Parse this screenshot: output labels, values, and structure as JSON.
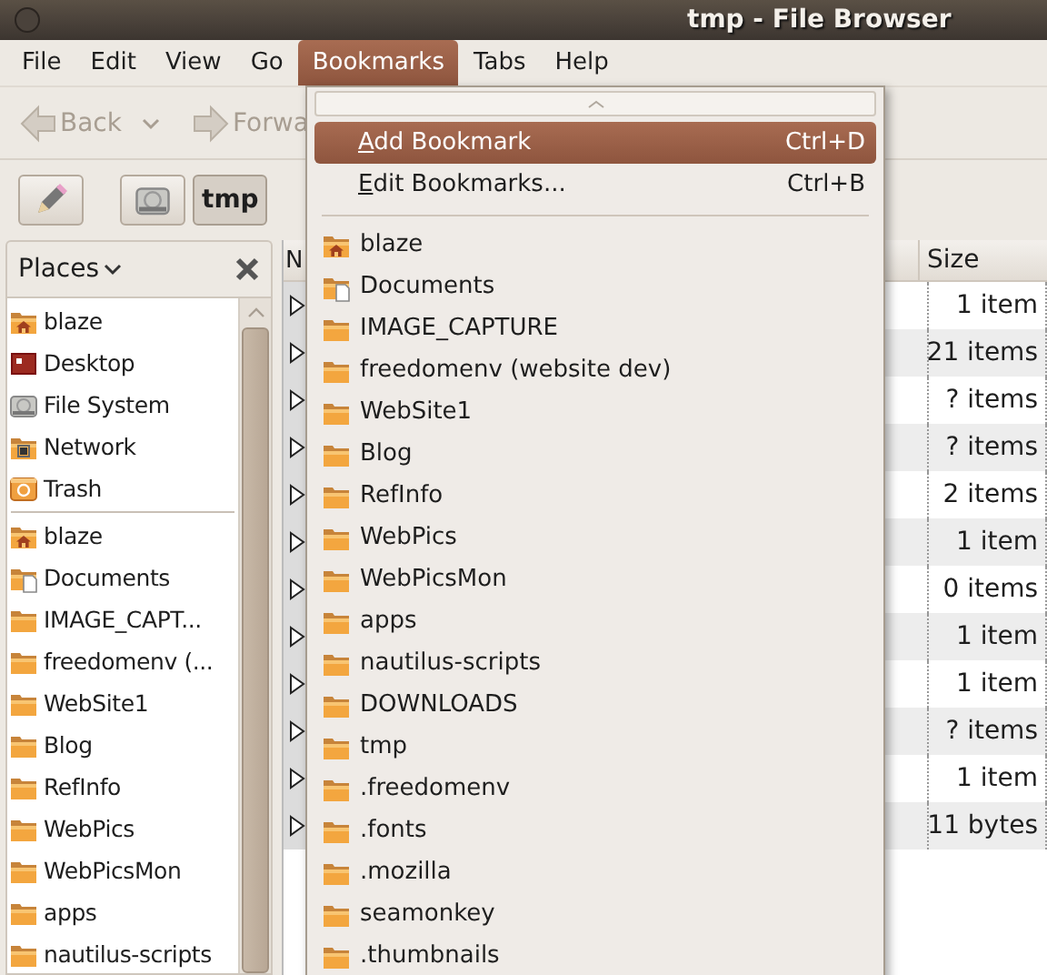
{
  "window": {
    "title": "tmp - File Browser"
  },
  "menubar": [
    {
      "label": "File",
      "selected": false
    },
    {
      "label": "Edit",
      "selected": false
    },
    {
      "label": "View",
      "selected": false
    },
    {
      "label": "Go",
      "selected": false
    },
    {
      "label": "Bookmarks",
      "selected": true
    },
    {
      "label": "Tabs",
      "selected": false
    },
    {
      "label": "Help",
      "selected": false
    }
  ],
  "toolbar": [
    {
      "kind": "back",
      "label": "Back",
      "disabled": true
    },
    {
      "kind": "forward",
      "label": "Forwa",
      "disabled": true
    }
  ],
  "path_bar": [
    {
      "kind": "drive",
      "selected": false
    },
    {
      "kind": "text",
      "label": "tmp",
      "selected": true
    }
  ],
  "sidebar": {
    "title": "Places",
    "items": [
      {
        "kind": "home",
        "label": "blaze"
      },
      {
        "kind": "desktop",
        "label": "Desktop"
      },
      {
        "kind": "drive",
        "label": "File System"
      },
      {
        "kind": "network",
        "label": "Network"
      },
      {
        "kind": "trash",
        "label": "Trash"
      },
      {
        "kind": "separator"
      },
      {
        "kind": "home",
        "label": "blaze"
      },
      {
        "kind": "documents",
        "label": "Documents"
      },
      {
        "kind": "folder",
        "label": "IMAGE_CAPT..."
      },
      {
        "kind": "folder",
        "label": "freedomenv (..."
      },
      {
        "kind": "folder",
        "label": "WebSite1"
      },
      {
        "kind": "folder",
        "label": "Blog"
      },
      {
        "kind": "folder",
        "label": "RefInfo"
      },
      {
        "kind": "folder",
        "label": "WebPics"
      },
      {
        "kind": "folder",
        "label": "WebPicsMon"
      },
      {
        "kind": "folder",
        "label": "apps"
      },
      {
        "kind": "folder",
        "label": "nautilus-scripts"
      }
    ]
  },
  "table": {
    "columns": [
      "N",
      "Size"
    ],
    "rows": [
      {
        "size": "1 item"
      },
      {
        "size": "21 items"
      },
      {
        "size": "? items"
      },
      {
        "size": "? items"
      },
      {
        "size": "2 items"
      },
      {
        "size": "1 item"
      },
      {
        "size": "0 items"
      },
      {
        "size": "1 item"
      },
      {
        "size": "1 item"
      },
      {
        "size": "? items"
      },
      {
        "size": "1 item"
      },
      {
        "size": "11 bytes"
      }
    ]
  },
  "bookmarks_menu": {
    "actions": [
      {
        "label": "Add Bookmark",
        "shortcut": "Ctrl+D",
        "selected": true
      },
      {
        "label": "Edit Bookmarks...",
        "shortcut": "Ctrl+B",
        "selected": false
      }
    ],
    "items": [
      {
        "kind": "home",
        "label": "blaze"
      },
      {
        "kind": "documents",
        "label": "Documents"
      },
      {
        "kind": "folder",
        "label": "IMAGE_CAPTURE"
      },
      {
        "kind": "folder",
        "label": "freedomenv (website dev)"
      },
      {
        "kind": "folder",
        "label": "WebSite1"
      },
      {
        "kind": "folder",
        "label": "Blog"
      },
      {
        "kind": "folder",
        "label": "RefInfo"
      },
      {
        "kind": "folder",
        "label": "WebPics"
      },
      {
        "kind": "folder",
        "label": "WebPicsMon"
      },
      {
        "kind": "folder",
        "label": "apps"
      },
      {
        "kind": "folder",
        "label": "nautilus-scripts"
      },
      {
        "kind": "folder",
        "label": "DOWNLOADS"
      },
      {
        "kind": "folder",
        "label": "tmp"
      },
      {
        "kind": "folder",
        "label": ".freedomenv"
      },
      {
        "kind": "folder",
        "label": ".fonts"
      },
      {
        "kind": "folder",
        "label": ".mozilla"
      },
      {
        "kind": "folder",
        "label": "seamonkey"
      },
      {
        "kind": "folder",
        "label": ".thumbnails"
      }
    ]
  }
}
